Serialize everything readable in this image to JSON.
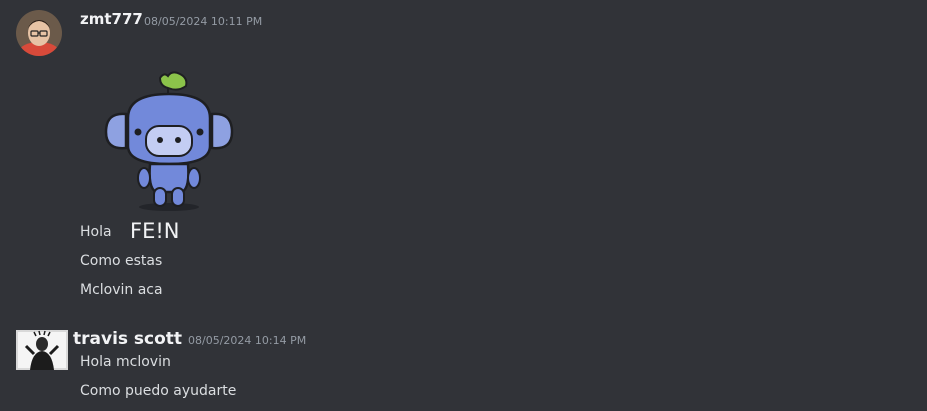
{
  "messages": [
    {
      "author": "zmt777",
      "timestamp": "08/05/2024 10:11 PM",
      "sticker": "wumpus-sticker",
      "lines": [
        "Hola",
        "FE!N",
        "Como estas",
        "Mclovin aca"
      ]
    },
    {
      "author": "travis scott",
      "timestamp": "08/05/2024 10:14 PM",
      "lines": [
        "Hola mclovin",
        "Como puedo ayudarte"
      ]
    }
  ],
  "colors": {
    "background": "#313338",
    "username": "#f2f3f5",
    "timestamp": "#949ba4",
    "text": "#dbdee1",
    "wumpus": "#7289da",
    "leaf": "#8bc34a"
  }
}
